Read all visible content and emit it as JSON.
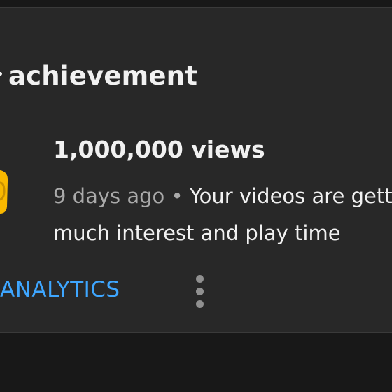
{
  "card": {
    "title": "achievement",
    "milestone": "1,000,000 views",
    "age": "9 days ago",
    "separator": "•",
    "message_line1": "Your videos are gett",
    "message_line2": "much interest and play time",
    "action_label": "ANALYTICS",
    "icons": [
      "trophy-icon",
      "more-vert-icon"
    ]
  },
  "colors": {
    "background": "#181818",
    "card": "#282828",
    "text": "#f1f1f1",
    "secondary_text": "#aaaaaa",
    "accent": "#3ea6ff",
    "trophy": "#f9b800"
  }
}
